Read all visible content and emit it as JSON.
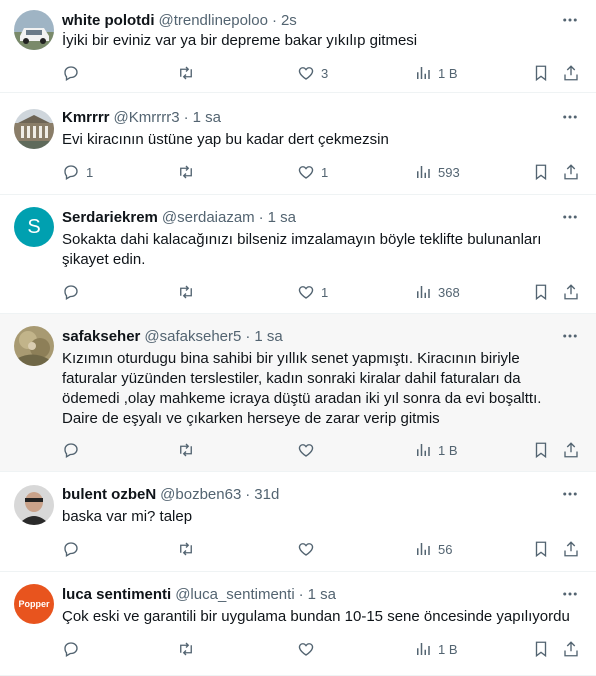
{
  "tweets": [
    {
      "name": "white polotdi",
      "handle": "@trendlinepoloo",
      "time": "2s",
      "lines": [
        "İyiki bir eviniz var ya bir depreme bakar yıkılıp gitmesi"
      ],
      "replies": "",
      "retweets": "",
      "likes": "3",
      "views": "1 B",
      "avatar": "car-photo"
    },
    {
      "name": "Kmrrrr",
      "handle": "@Kmrrrr3",
      "time": "1 sa",
      "lines": [
        "Evi kiracının üstüne yap bu kadar dert çekmezsin"
      ],
      "replies": "1",
      "retweets": "",
      "likes": "1",
      "views": "593",
      "avatar": "building-photo"
    },
    {
      "name": "Serdariekrem",
      "handle": "@serdaiazam",
      "time": "1 sa",
      "lines": [
        "Sokakta dahi kalacağınızı bilseniz imzalamayın böyle teklifte bulunanları",
        "şikayet edin."
      ],
      "replies": "",
      "retweets": "",
      "likes": "1",
      "views": "368",
      "avatar": "letter-S",
      "avatar_letter": "S",
      "avatar_color": "#00a0b0"
    },
    {
      "name": "safakseher",
      "handle": "@safakseher5",
      "time": "1 sa",
      "lines": [
        "Kızımın oturdugu bina sahibi bir yıllık senet yapmıştı. Kiracının biriyle",
        "faturalar yüzünden terslestiler, kadın sonraki kiralar dahil faturaları da",
        "ödemedi ,olay mahkeme icraya düştü aradan iki yıl sonra da evi boşalttı.",
        "Daire de eşyalı ve çıkarken herseye de zarar verip gitmis"
      ],
      "replies": "",
      "retweets": "",
      "likes": "",
      "views": "1 B",
      "avatar": "painting-photo"
    },
    {
      "name": "bulent ozbeN",
      "handle": "@bozben63",
      "time": "31d",
      "lines": [
        "baska var mi? talep"
      ],
      "replies": "",
      "retweets": "",
      "likes": "",
      "views": "56",
      "avatar": "person-photo"
    },
    {
      "name": "luca sentimenti",
      "handle": "@luca_sentimenti",
      "time": "1 sa",
      "lines": [
        "Çok eski ve garantili bir uygulama bundan 10-15 sene öncesinde yapılıyordu"
      ],
      "replies": "",
      "retweets": "",
      "likes": "",
      "views": "1 B",
      "avatar": "popper-logo",
      "avatar_text": "Popper"
    }
  ],
  "colors": {
    "text": "#0f1419",
    "secondary": "#536471",
    "divider": "#eff3f4",
    "highlight_bg": "#f7f7f7"
  }
}
